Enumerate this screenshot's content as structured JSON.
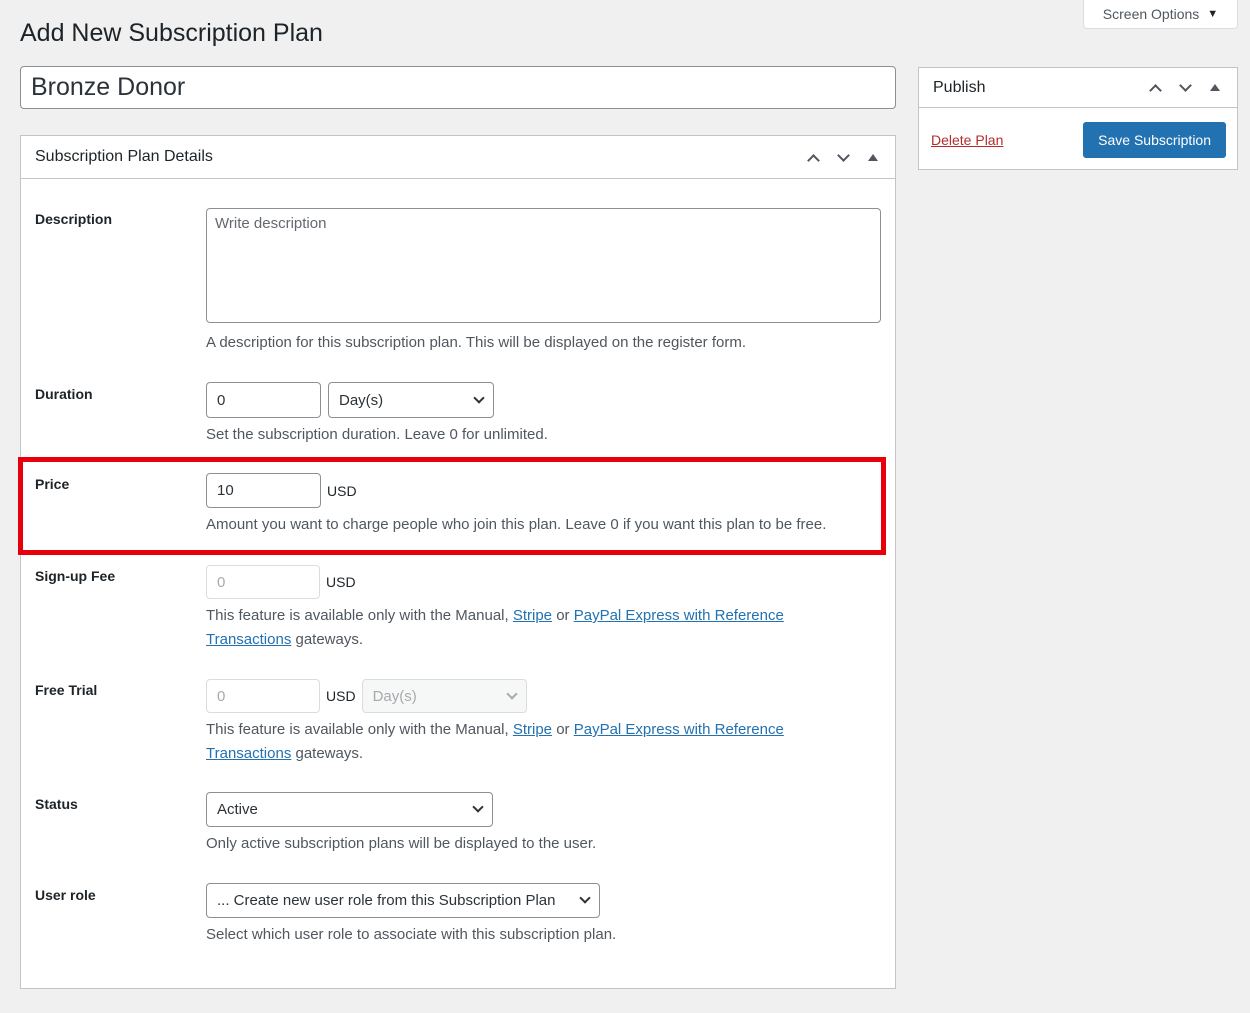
{
  "screen_options": {
    "label": "Screen Options"
  },
  "page": {
    "title": "Add New Subscription Plan",
    "plan_name": "Bronze Donor"
  },
  "details": {
    "title": "Subscription Plan Details",
    "description": {
      "label": "Description",
      "placeholder": "Write description",
      "help": "A description for this subscription plan. This will be displayed on the register form."
    },
    "duration": {
      "label": "Duration",
      "value": "0",
      "unit": "Day(s)",
      "help": "Set the subscription duration. Leave 0 for unlimited."
    },
    "price": {
      "label": "Price",
      "value": "10",
      "currency": "USD",
      "help": "Amount you want to charge people who join this plan. Leave 0 if you want this plan to be free."
    },
    "signup_fee": {
      "label": "Sign-up Fee",
      "value": "0",
      "currency": "USD",
      "help_pre": "This feature is available only with the Manual,",
      "link_stripe": "Stripe",
      "help_or": "or",
      "link_paypal": "PayPal Express with Reference Transactions",
      "help_post": "gateways."
    },
    "free_trial": {
      "label": "Free Trial",
      "value": "0",
      "currency": "USD",
      "unit": "Day(s)",
      "help_pre": "This feature is available only with the Manual,",
      "link_stripe": "Stripe",
      "help_or": "or",
      "link_paypal": "PayPal Express with Reference Transactions",
      "help_post": "gateways."
    },
    "status": {
      "label": "Status",
      "value": "Active",
      "help": "Only active subscription plans will be displayed to the user."
    },
    "user_role": {
      "label": "User role",
      "value": "... Create new user role from this Subscription Plan",
      "help": "Select which user role to associate with this subscription plan."
    }
  },
  "publish": {
    "title": "Publish",
    "delete_label": "Delete Plan",
    "save_label": "Save Subscription"
  },
  "colors": {
    "primary": "#2271b1",
    "danger": "#b32d2e",
    "highlight": "#e7000b",
    "background": "#f0f0f1"
  }
}
